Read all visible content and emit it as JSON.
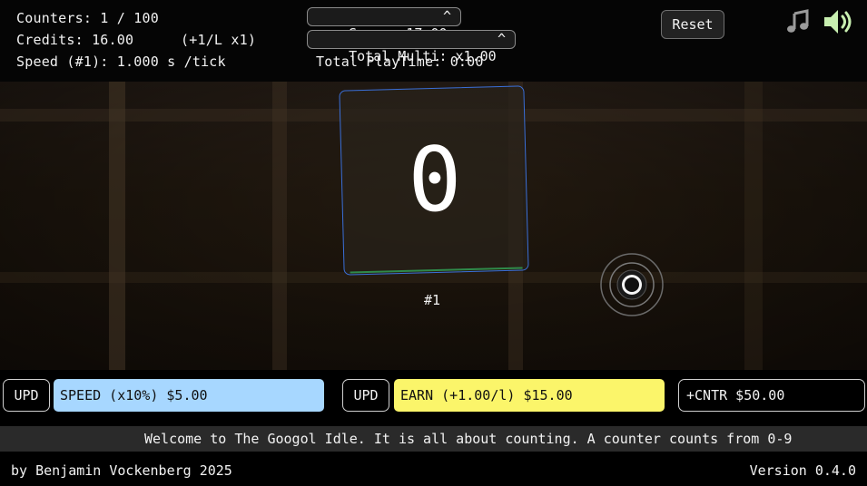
{
  "stats": {
    "counters": "Counters: 1 / 100",
    "credits": "Credits: 16.00",
    "credit_rate": "(+1/L x1)",
    "speed": "Speed (#1): 1.000 s /tick"
  },
  "score_pill": {
    "label": "Score: 17.00",
    "caret": "^"
  },
  "multi_pill": {
    "label": "Total Multi: x1.00",
    "caret": "^"
  },
  "playtime": "Total PlayTime: 0:00",
  "reset_label": "Reset",
  "icons": {
    "music": "music-note-icon",
    "sound": "speaker-volume-icon",
    "orb": "target-ring-icon"
  },
  "counter": {
    "digit": "0",
    "label": "#1"
  },
  "buttons": {
    "upd_1": "UPD",
    "speed": "SPEED (x10%) $5.00",
    "upd_2": "UPD",
    "earn": "EARN (+1.00/l) $15.00",
    "cntr": "+CNTR $50.00"
  },
  "ticker": "Welcome to The Googol Idle. It is all about counting. A counter counts from 0-9",
  "footer": {
    "author": "by Benjamin Vockenberg 2025",
    "version": "Version 0.4.0"
  },
  "colors": {
    "speed_button": "#a7d7ff",
    "earn_button": "#fbf56a",
    "card_border": "#3a6fd8",
    "card_progress": "#2f8a4a"
  }
}
